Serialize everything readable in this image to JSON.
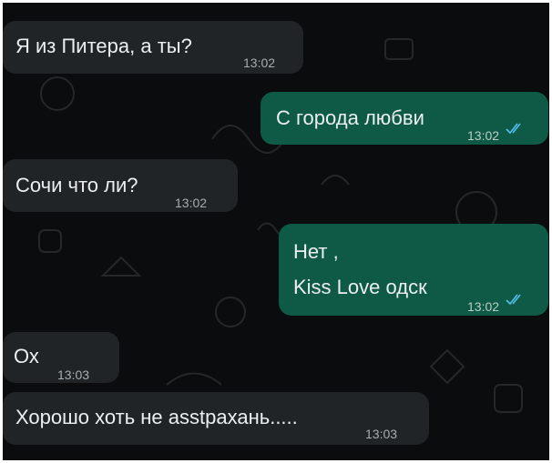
{
  "messages": [
    {
      "direction": "incoming",
      "text": "Я из Питера,  а ты?",
      "time": "13:02"
    },
    {
      "direction": "outgoing",
      "text": "С города любви",
      "time": "13:02",
      "status": "read-double-check-icon"
    },
    {
      "direction": "incoming",
      "text": "Сочи что ли?",
      "time": "13:02"
    },
    {
      "direction": "outgoing",
      "lines": [
        "Нет ,",
        "Kiss Love одск"
      ],
      "time": "13:02",
      "status": "read-double-check-icon"
    },
    {
      "direction": "incoming",
      "text": "Ох",
      "time": "13:03"
    },
    {
      "direction": "incoming",
      "text": "Хорошо хоть не asstрахань.....",
      "time": "13:03"
    }
  ],
  "colors": {
    "background": "#0b0c0d",
    "incoming_bubble": "#202426",
    "outgoing_bubble": "#0f5a46",
    "read_ticks": "#53bdeb"
  }
}
